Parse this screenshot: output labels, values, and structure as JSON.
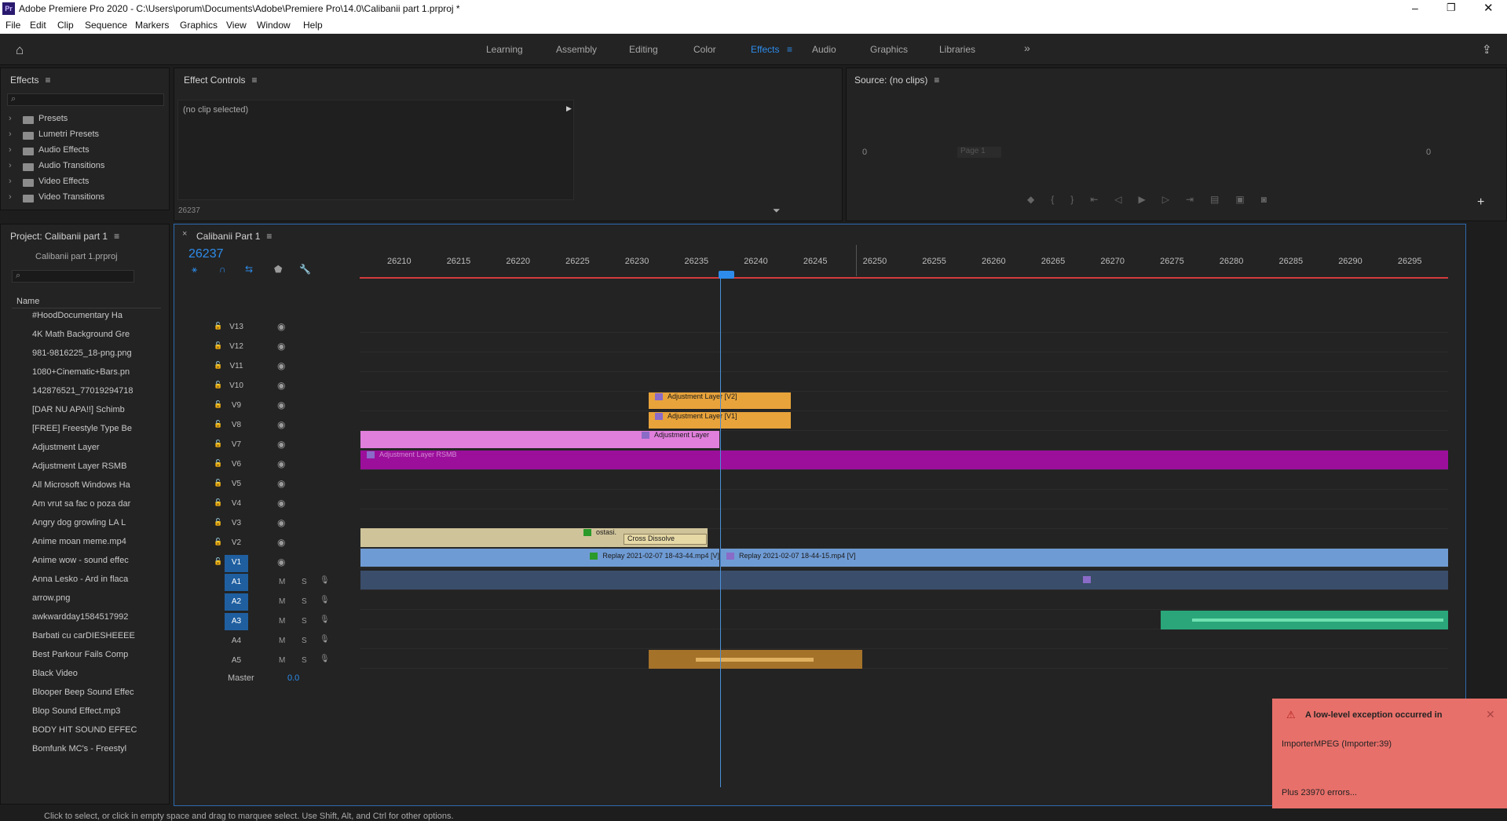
{
  "window": {
    "title": "Adobe Premiere Pro 2020 - C:\\Users\\porum\\Documents\\Adobe\\Premiere Pro\\14.0\\Calibanii part 1.prproj *",
    "app_badge": "Pr"
  },
  "menu": [
    "File",
    "Edit",
    "Clip",
    "Sequence",
    "Markers",
    "Graphics",
    "View",
    "Window",
    "Help"
  ],
  "workspaces": [
    "Learning",
    "Assembly",
    "Editing",
    "Color",
    "Effects",
    "Audio",
    "Graphics",
    "Libraries"
  ],
  "active_workspace": "Effects",
  "effects_panel": {
    "title": "Effects",
    "items": [
      "Presets",
      "Lumetri Presets",
      "Audio Effects",
      "Audio Transitions",
      "Video Effects",
      "Video Transitions"
    ]
  },
  "effect_controls": {
    "title": "Effect Controls",
    "no_clip": "(no clip selected)",
    "timecode": "26237"
  },
  "source": {
    "title": "Source: (no clips)",
    "left_num": "0",
    "right_num": "0",
    "page": "Page 1"
  },
  "project": {
    "title": "Project: Calibanii part 1",
    "file": "Calibanii part 1.prproj",
    "col_name": "Name",
    "items": [
      "#HoodDocumentary Ha",
      "4K Math Background Gre",
      "981-9816225_18-png.png",
      "1080+Cinematic+Bars.pn",
      "142876521_77019294718",
      "[DAR NU APA!!] Schimb",
      "[FREE] Freestyle Type Be",
      "Adjustment Layer",
      "Adjustment Layer RSMB",
      "All Microsoft Windows Ha",
      "Am vrut sa fac o poza dar",
      "Angry dog growling LA L",
      "Anime moan meme.mp4",
      "Anime wow - sound effec",
      "Anna Lesko - Ard in flaca",
      "arrow.png",
      "awkwardday1584517992",
      "Barbati cu carDIESHEEEE",
      "Best Parkour Fails Comp",
      "Black Video",
      "Blooper Beep Sound Effec",
      "Blop Sound Effect.mp3",
      "BODY HIT SOUND EFFEC",
      "Bomfunk MC's - Freestyl"
    ]
  },
  "timeline": {
    "title": "Calibanii Part 1",
    "timecode": "26237",
    "ruler": [
      "26210",
      "26215",
      "26220",
      "26225",
      "26230",
      "26235",
      "26240",
      "26245",
      "26250",
      "26255",
      "26260",
      "26265",
      "26270",
      "26275",
      "26280",
      "26285",
      "26290",
      "26295"
    ],
    "video_tracks": [
      "V13",
      "V12",
      "V11",
      "V10",
      "V9",
      "V8",
      "V7",
      "V6",
      "V5",
      "V4",
      "V3",
      "V2",
      "V1"
    ],
    "audio_tracks": [
      "A1",
      "A2",
      "A3",
      "A4",
      "A5"
    ],
    "master_label": "Master",
    "master_value": "0.0",
    "clips": {
      "adj_v2": "Adjustment Layer [V2]",
      "adj_v1": "Adjustment Layer [V1]",
      "adj": "Adjustment Layer",
      "adj_rsmb": "Adjustment Layer RSMB",
      "ostasi": "ostasi.",
      "cross": "Cross Dissolve",
      "replay1": "Replay 2021-02-07 18-43-44.mp4 [V]",
      "replay2": "Replay 2021-02-07 18-44-15.mp4 [V]"
    },
    "track_buttons": {
      "mute": "M",
      "solo": "S"
    }
  },
  "error": {
    "title": "A low-level exception occurred in",
    "body": "ImporterMPEG (Importer:39)",
    "more": "Plus 23970 errors..."
  },
  "status": "Click to select, or click in empty space and drag to marquee select. Use Shift, Alt, and Ctrl for other options.",
  "colors": {
    "accent": "#2d8ceb",
    "playhead": "#4a90d9",
    "adjust": "#e8a33b",
    "pink": "#e07fdc",
    "purple": "#9b0f9b",
    "tan": "#cfc39a",
    "blue": "#6f9bd4",
    "audio_green": "#2aa67a",
    "error": "#e8706a"
  }
}
